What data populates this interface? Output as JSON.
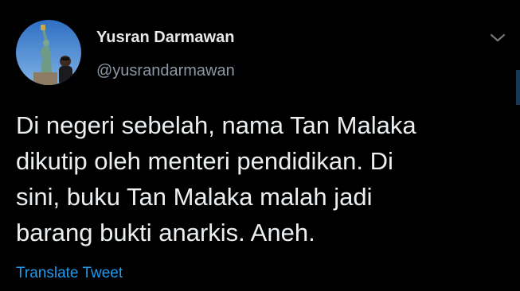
{
  "author": {
    "display_name": "Yusran Darmawan",
    "handle": "@yusrandarmawan",
    "avatar_icon": "profile-photo-statue-of-liberty"
  },
  "tweet": {
    "lines": [
      "Di negeri sebelah, nama Tan Malaka",
      "dikutip oleh menteri pendidikan. Di",
      "sini, buku Tan Malaka malah jadi",
      "barang bukti anarkis. Aneh."
    ],
    "translate_label": "Translate Tweet"
  },
  "menu": {
    "icon": "chevron-down-icon"
  },
  "colors": {
    "background": "#000000",
    "text": "#e7e9ea",
    "secondary": "#8b98a5",
    "accent": "#1d9bf0"
  }
}
